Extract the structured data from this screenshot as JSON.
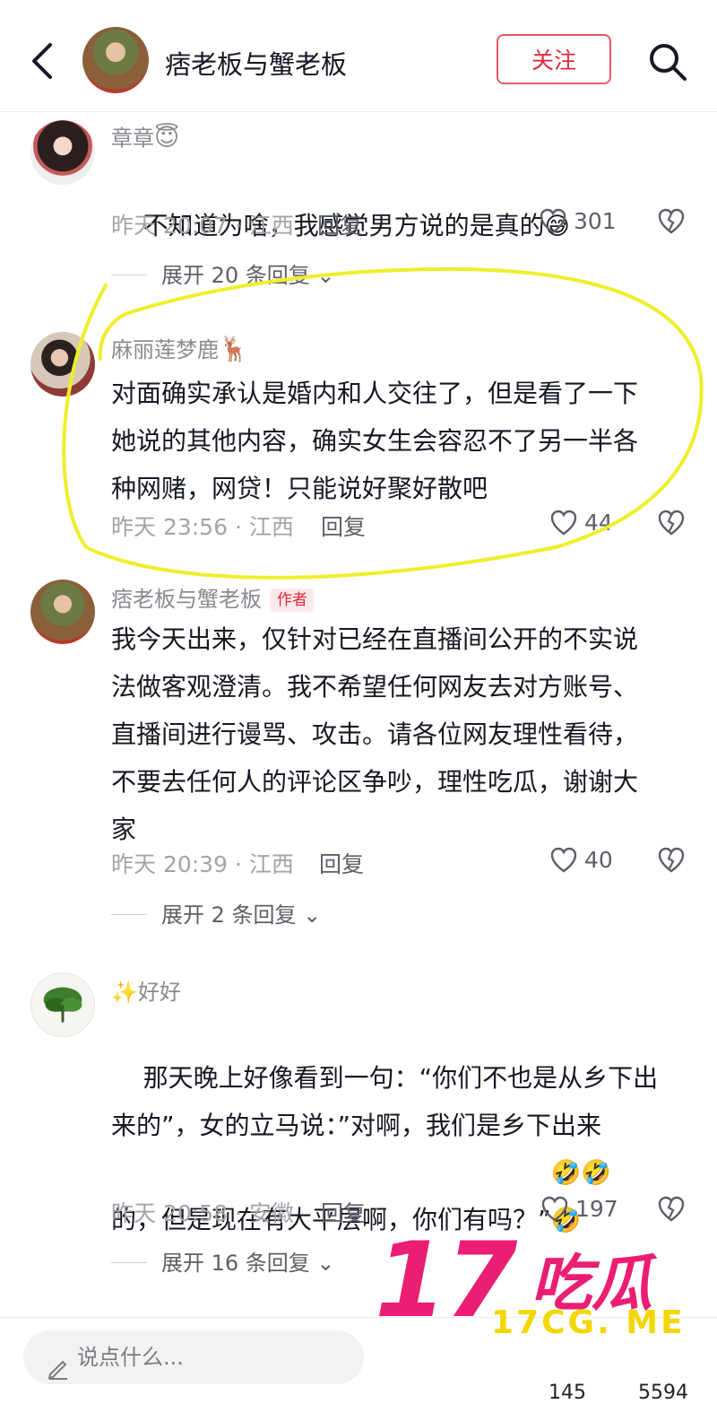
{
  "header": {
    "title": "痞老板与蟹老板",
    "follow_label": "关注"
  },
  "comments": [
    {
      "username": "章章",
      "username_emoji": "😇",
      "text": "不知道为啥，我感觉男方说的是真的",
      "text_emoji": "😅",
      "meta": "昨天 20:07 · 江西",
      "reply_label": "回复",
      "likes": "301",
      "expand_label": "展开 20 条回复"
    },
    {
      "username": "麻丽莲梦鹿",
      "username_emoji": "🦌",
      "text": "对面确实承认是婚内和人交往了，但是看了一下\n她说的其他内容，确实女生会容忍不了另一半各\n种网赌，网贷！只能说好聚好散吧",
      "meta": "昨天 23:56 · 江西",
      "reply_label": "回复",
      "likes": "44"
    },
    {
      "username": "痞老板与蟹老板",
      "author_badge": "作者",
      "text": "我今天出来，仅针对已经在直播间公开的不实说\n法做客观澄清。我不希望任何网友去对方账号、\n直播间进行谩骂、攻击。请各位网友理性看待，\n不要去任何人的评论区争吵，理性吃瓜，谢谢大\n家",
      "meta": "昨天 20:39 · 江西",
      "reply_label": "回复",
      "likes": "40",
      "expand_label": "展开 2 条回复"
    },
    {
      "username": "✨好好",
      "text": "那天晚上好像看到一句：“你们不也是从乡下出\n来的”，女的立马说：”对啊，我们是乡下出来\n的，但是现在有大平层啊，你们有吗？”",
      "text_emoji": "🤣🤣\n🤣",
      "meta": "昨天 20:58 · 安徽",
      "reply_label": "回复",
      "likes": "197",
      "expand_label": "展开 16 条回复"
    }
  ],
  "bottom_bar": {
    "input_placeholder": "说点什么...",
    "counts": [
      "145",
      "5594"
    ]
  },
  "watermark": {
    "number": "17",
    "chinese": "吃瓜",
    "url": "17CG. ME"
  },
  "colors": {
    "accent_red": "#e3283d",
    "highlight_yellow": "#f0ee2a",
    "watermark_pink": "#ea1e73",
    "watermark_yellow": "#f4d600"
  }
}
